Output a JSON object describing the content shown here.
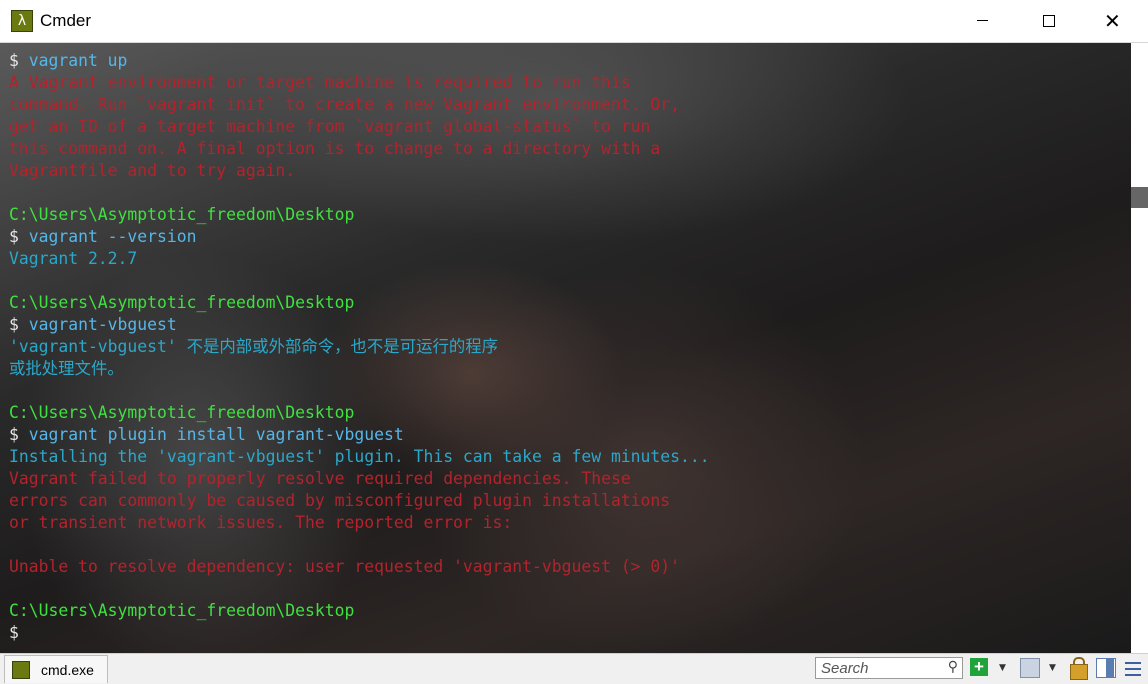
{
  "window": {
    "title": "Cmder"
  },
  "console": {
    "lines": [
      {
        "text": "$ vagrant up",
        "kind": "cmd"
      },
      {
        "text": "A Vagrant environment or target machine is required to run this",
        "kind": "err"
      },
      {
        "text": "command. Run `vagrant init` to create a new Vagrant environment. Or,",
        "kind": "err"
      },
      {
        "text": "get an ID of a target machine from `vagrant global-status` to run",
        "kind": "err"
      },
      {
        "text": "this command on. A final option is to change to a directory with a",
        "kind": "err"
      },
      {
        "text": "Vagrantfile and to try again.",
        "kind": "err"
      },
      {
        "text": "",
        "kind": "blank"
      },
      {
        "text": "C:\\Users\\Asymptotic_freedom\\Desktop",
        "kind": "path"
      },
      {
        "text": "$ vagrant --version",
        "kind": "cmd"
      },
      {
        "text": "Vagrant 2.2.7",
        "kind": "info"
      },
      {
        "text": "",
        "kind": "blank"
      },
      {
        "text": "C:\\Users\\Asymptotic_freedom\\Desktop",
        "kind": "path"
      },
      {
        "text": "$ vagrant-vbguest",
        "kind": "cmd"
      },
      {
        "text": "'vagrant-vbguest' 不是内部或外部命令，也不是可运行的程序",
        "kind": "info"
      },
      {
        "text": "或批处理文件。",
        "kind": "info"
      },
      {
        "text": "",
        "kind": "blank"
      },
      {
        "text": "C:\\Users\\Asymptotic_freedom\\Desktop",
        "kind": "path"
      },
      {
        "text": "$ vagrant plugin install vagrant-vbguest",
        "kind": "cmd"
      },
      {
        "text": "Installing the 'vagrant-vbguest' plugin. This can take a few minutes...",
        "kind": "info"
      },
      {
        "text": "Vagrant failed to properly resolve required dependencies. These",
        "kind": "err"
      },
      {
        "text": "errors can commonly be caused by misconfigured plugin installations",
        "kind": "err"
      },
      {
        "text": "or transient network issues. The reported error is:",
        "kind": "err"
      },
      {
        "text": "",
        "kind": "blank"
      },
      {
        "text": "Unable to resolve dependency: user requested 'vagrant-vbguest (> 0)'",
        "kind": "err"
      },
      {
        "text": "",
        "kind": "blank"
      },
      {
        "text": "C:\\Users\\Asymptotic_freedom\\Desktop",
        "kind": "path"
      },
      {
        "text": "$",
        "kind": "cmd"
      }
    ]
  },
  "statusbar": {
    "tab_label": "cmd.exe",
    "search_placeholder": "Search"
  },
  "icons": {
    "app": "lambda-icon",
    "tab": "cmder-tab-icon",
    "search": "magnifier-icon",
    "add": "plus-icon",
    "views": "window-views-icon",
    "lock": "lock-icon",
    "split": "split-pane-icon",
    "menu": "hamburger-menu-icon"
  },
  "colors": {
    "error": "#b3232c",
    "path": "#3ee13e",
    "info": "#2aa7c9",
    "command": "#56b6e8"
  }
}
